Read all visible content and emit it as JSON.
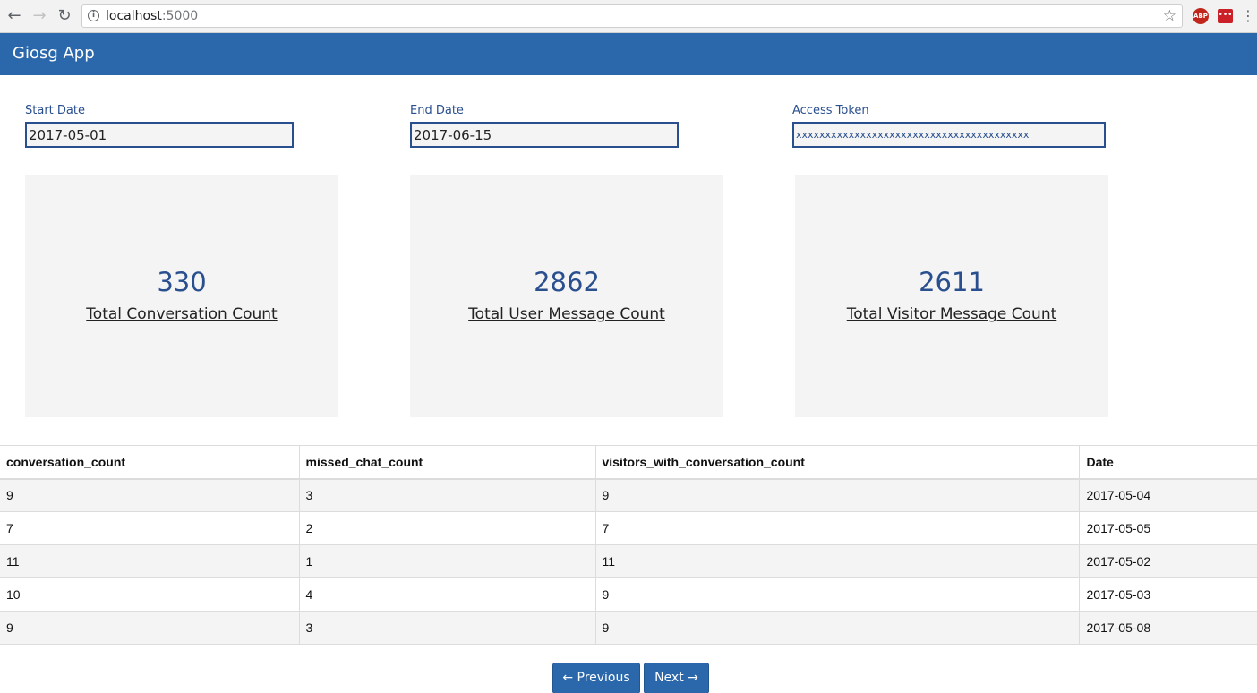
{
  "browser": {
    "url_host": "localhost",
    "url_port": ":5000",
    "back_icon": "arrow-left-icon",
    "forward_icon": "arrow-right-icon",
    "reload_icon": "reload-icon",
    "extensions": {
      "abp": "ABP",
      "lastpass": "•••"
    }
  },
  "app": {
    "brand": "Giosg App"
  },
  "form": {
    "start_label": "Start Date",
    "start_value": "2017-05-01",
    "end_label": "End Date",
    "end_value": "2017-06-15",
    "token_label": "Access Token",
    "token_value": "xxxxxxxxxxxxxxxxxxxxxxxxxxxxxxxxxxxxxxxx"
  },
  "stats": [
    {
      "value": "330",
      "label": "Total Conversation Count"
    },
    {
      "value": "2862",
      "label": "Total User Message Count"
    },
    {
      "value": "2611",
      "label": "Total Visitor Message Count"
    }
  ],
  "table": {
    "headers": [
      "conversation_count",
      "missed_chat_count",
      "visitors_with_conversation_count",
      "Date"
    ],
    "rows": [
      [
        "9",
        "3",
        "9",
        "2017-05-04"
      ],
      [
        "7",
        "2",
        "7",
        "2017-05-05"
      ],
      [
        "11",
        "1",
        "11",
        "2017-05-02"
      ],
      [
        "10",
        "4",
        "9",
        "2017-05-03"
      ],
      [
        "9",
        "3",
        "9",
        "2017-05-08"
      ]
    ]
  },
  "pager": {
    "prev": "← Previous",
    "next": "Next →"
  },
  "colors": {
    "navbar": "#2b67ab",
    "accent": "#2a4f8f",
    "card_bg": "#f4f4f4"
  }
}
